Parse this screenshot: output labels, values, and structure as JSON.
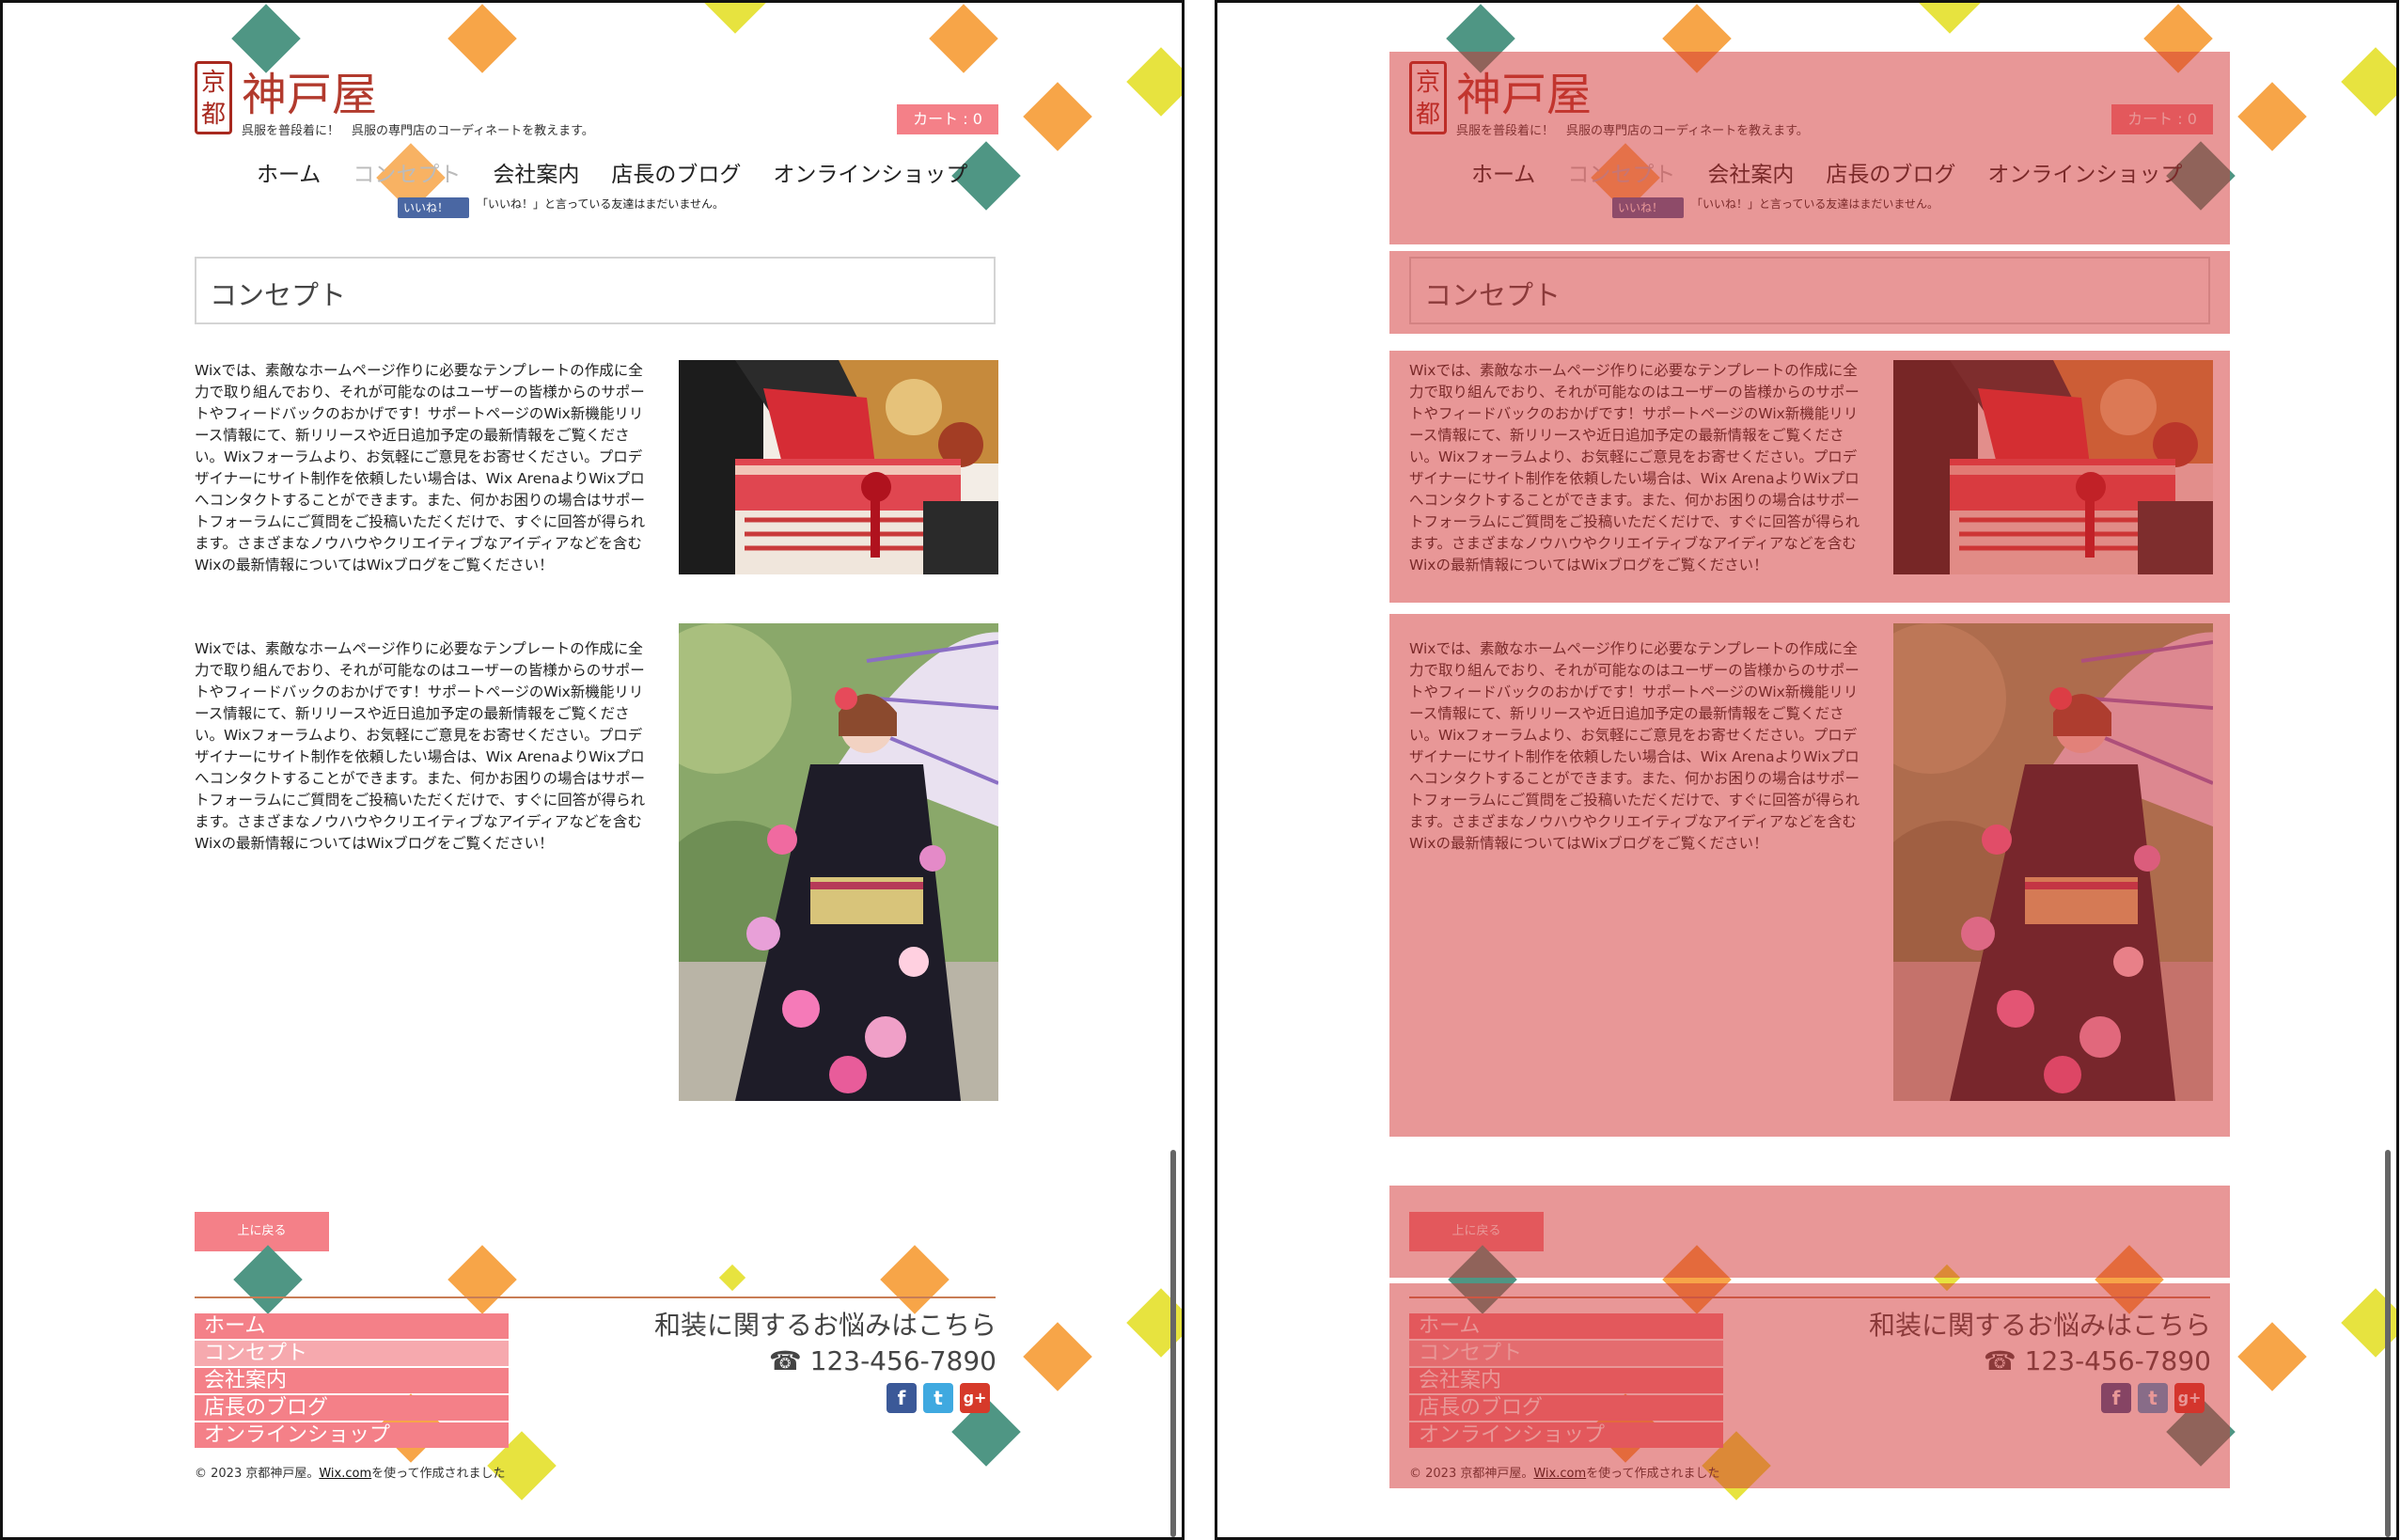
{
  "site": {
    "logo_seal_line1": "京",
    "logo_seal_line2": "都",
    "logo_name": "神戸屋",
    "tagline": "呉服を普段着に！　呉服の専門店のコーディネートを教えます。",
    "cart_label": "カート : 0"
  },
  "nav": {
    "items": [
      "ホーム",
      "コンセプト",
      "会社案内",
      "店長のブログ",
      "オンラインショップ"
    ],
    "active_index": 1
  },
  "facebook": {
    "like_label": "いいね！",
    "like_text": "「いいね！」と言っている友達はまだいません。"
  },
  "main": {
    "title": "コンセプト",
    "paragraph_1": "Wixでは、素敵なホームページ作りに必要なテンプレートの作成に全力で取り組んでおり、それが可能なのはユーザーの皆様からのサポートやフィードバックのおかげです！サポートページのWix新機能リリース情報にて、新リリースや近日追加予定の最新情報をご覧ください。Wixフォーラムより、お気軽にご意見をお寄せください。プロデザイナーにサイト制作を依頼したい場合は、Wix ArenaよりWixプロへコンタクトすることができます。また、何かお困りの場合はサポートフォーラムにご質問をご投稿いただくだけで、すぐに回答が得られます。さまざまなノウハウやクリエイティブなアイディアなどを含むWixの最新情報についてはWixブログをご覧ください！",
    "paragraph_2": "Wixでは、素敵なホームページ作りに必要なテンプレートの作成に全力で取り組んでおり、それが可能なのはユーザーの皆様からのサポートやフィードバックのおかげです！サポートページのWix新機能リリース情報にて、新リリースや近日追加予定の最新情報をご覧ください。Wixフォーラムより、お気軽にご意見をお寄せください。プロデザイナーにサイト制作を依頼したい場合は、Wix ArenaよりWixプロへコンタクトすることができます。また、何かお困りの場合はサポートフォーラムにご質問をご投稿いただくだけで、すぐに回答が得られます。さまざまなノウハウやクリエイティブなアイディアなどを含むWixの最新情報についてはWixブログをご覧ください！",
    "back_to_top": "上に戻る"
  },
  "footer": {
    "menu": [
      "ホーム",
      "コンセプト",
      "会社案内",
      "店長のブログ",
      "オンラインショップ"
    ],
    "contact_heading": "和装に関するお悩みはこちら",
    "phone": "☎ 123-456-7890",
    "social": [
      "facebook-icon",
      "twitter-icon",
      "google-plus-icon"
    ],
    "copyright_prefix": "© 2023 京都神戸屋。",
    "copyright_link": "Wix.com",
    "copyright_suffix": "を使って作成されました"
  },
  "colors": {
    "accent_pink": "#f48088",
    "logo_red": "#b23a2d",
    "overlay_red": "#d23030",
    "diamond_teal": "#4f9684",
    "diamond_orange": "#f7a548",
    "diamond_yellow": "#e7e33f"
  }
}
